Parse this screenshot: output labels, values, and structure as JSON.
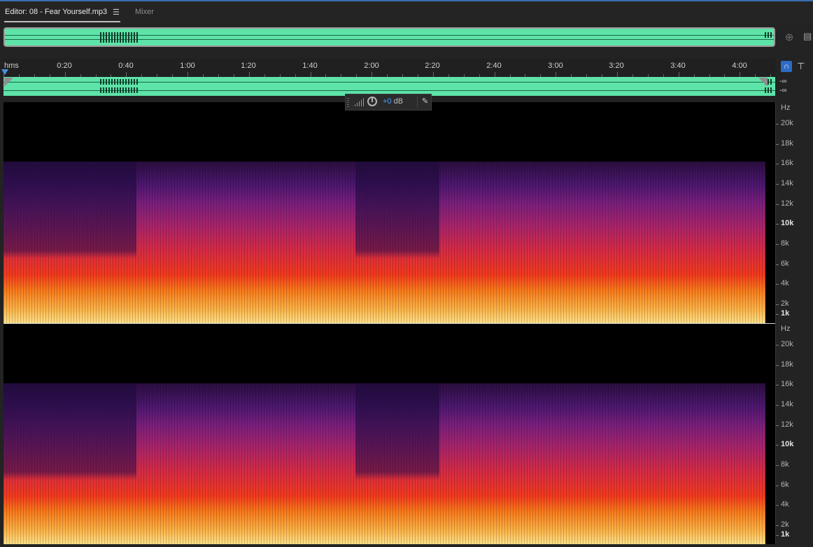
{
  "tabs": {
    "editor_label": "Editor: 08 - Fear Yourself.mp3",
    "editor_menu_icon": "hamburger-menu-icon",
    "mixer_label": "Mixer"
  },
  "ruler": {
    "unit": "hms",
    "labels": [
      "0:20",
      "0:40",
      "1:00",
      "1:20",
      "1:40",
      "2:00",
      "2:20",
      "2:40",
      "3:00",
      "3:20",
      "3:40",
      "4:00"
    ]
  },
  "meter": {
    "top": "-∞",
    "bottom": "-∞"
  },
  "hud": {
    "value": "+0",
    "unit": "dB"
  },
  "frequency_axis": {
    "unit": "Hz",
    "labels": [
      "20k",
      "18k",
      "16k",
      "14k",
      "12k",
      "10k",
      "8k",
      "6k",
      "4k",
      "2k",
      "1k"
    ]
  },
  "colors": {
    "waveform": "#5ee3a8",
    "accent": "#2d6bc4",
    "hud_value": "#4aa3ff"
  },
  "icons": {
    "zoom_navigator": "zoom-crosshair-icon",
    "panel_menu": "panel-menu-icon",
    "snap": "magnet-snap-icon",
    "marker": "marker-pin-icon",
    "hud_pin": "pin-icon"
  }
}
